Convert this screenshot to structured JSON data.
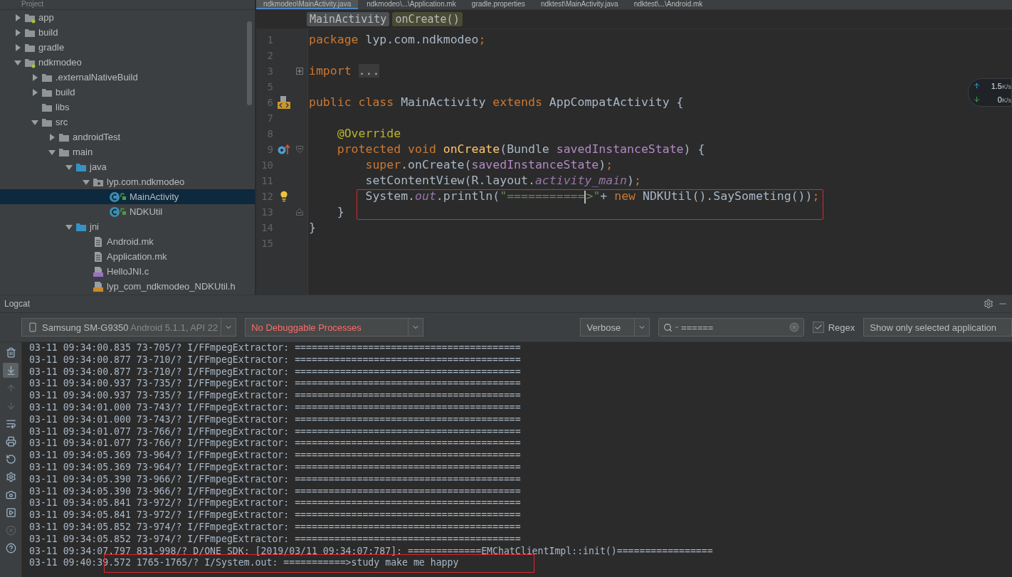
{
  "project_panel": {
    "title": "Project",
    "tree": [
      {
        "label": "app",
        "kind": "module",
        "expanded": false,
        "selected": false
      },
      {
        "label": "build",
        "kind": "folder",
        "expanded": false,
        "selected": false
      },
      {
        "label": "gradle",
        "kind": "folder",
        "expanded": false,
        "selected": false
      },
      {
        "label": "ndkmodeo",
        "kind": "module",
        "expanded": true,
        "selected": false,
        "children": [
          {
            "label": ".externalNativeBuild",
            "kind": "folder",
            "expanded": false,
            "selected": false
          },
          {
            "label": "build",
            "kind": "folder",
            "expanded": false,
            "selected": false
          },
          {
            "label": "libs",
            "kind": "folder",
            "selected": false
          },
          {
            "label": "src",
            "kind": "folder",
            "expanded": true,
            "selected": false,
            "children": [
              {
                "label": "androidTest",
                "kind": "folder",
                "expanded": false,
                "selected": false
              },
              {
                "label": "main",
                "kind": "folder",
                "expanded": true,
                "selected": false,
                "children": [
                  {
                    "label": "java",
                    "kind": "source",
                    "expanded": true,
                    "selected": false,
                    "children": [
                      {
                        "label": "lyp.com.ndkmodeo",
                        "kind": "package",
                        "expanded": true,
                        "selected": false,
                        "children": [
                          {
                            "label": "MainActivity",
                            "kind": "class",
                            "selected": true
                          },
                          {
                            "label": "NDKUtil",
                            "kind": "class",
                            "selected": false
                          }
                        ]
                      }
                    ]
                  },
                  {
                    "label": "jni",
                    "kind": "source",
                    "expanded": true,
                    "selected": false,
                    "children": [
                      {
                        "label": "Android.mk",
                        "kind": "text",
                        "selected": false
                      },
                      {
                        "label": "Application.mk",
                        "kind": "text",
                        "selected": false
                      },
                      {
                        "label": "HelloJNI.c",
                        "kind": "c",
                        "selected": false
                      },
                      {
                        "label": "lyp_com_ndkmodeo_NDKUtil.h",
                        "kind": "h",
                        "selected": false
                      }
                    ]
                  }
                ]
              }
            ]
          }
        ]
      }
    ]
  },
  "editor_tabs": [
    {
      "label": "ndkmodeo\\MainActivity.java",
      "selected": true
    },
    {
      "label": "ndkmodeo\\...\\Application.mk",
      "selected": false
    },
    {
      "label": "gradle.properties",
      "selected": false
    },
    {
      "label": "ndktest\\MainActivity.java",
      "selected": false
    },
    {
      "label": "ndktest\\...\\Android.mk",
      "selected": false
    }
  ],
  "breadcrumbs": [
    {
      "label": "MainActivity",
      "selected": false
    },
    {
      "label": "onCreate()",
      "selected": true
    }
  ],
  "code_lines": [
    {
      "number": "1",
      "tokens": [
        {
          "kind": "kw",
          "text": "package"
        },
        {
          "kind": "plain",
          "text": " lyp.com.ndkmodeo"
        },
        {
          "kind": "kw",
          "text": ";"
        }
      ]
    },
    {
      "number": "2"
    },
    {
      "number": "3",
      "gutter": [
        {
          "kind": "fold-plus"
        }
      ],
      "tokens": [
        {
          "kind": "kw",
          "text": "import"
        },
        {
          "kind": "folded",
          "text": "..."
        }
      ]
    },
    {
      "number": "5"
    },
    {
      "number": "6",
      "gutter": [
        {
          "kind": "layout"
        }
      ],
      "tokens": [
        {
          "kind": "kw",
          "text": "public class "
        },
        {
          "kind": "plain",
          "text": "MainActivity "
        },
        {
          "kind": "kw",
          "text": "extends "
        },
        {
          "kind": "plain",
          "text": "AppCompatActivity {"
        }
      ]
    },
    {
      "number": "7"
    },
    {
      "number": "8",
      "tokens": [
        {
          "kind": "annot",
          "text": "    @Override"
        }
      ]
    },
    {
      "number": "9",
      "gutter": [
        {
          "kind": "override"
        },
        {
          "kind": "fold-open"
        }
      ],
      "tokens": [
        {
          "kind": "kw",
          "text": "    protected void "
        },
        {
          "kind": "decl",
          "text": "onCreate"
        },
        {
          "kind": "plain",
          "text": "(Bundle "
        },
        {
          "kind": "param",
          "text": "savedInstanceState"
        },
        {
          "kind": "plain",
          "text": ") {"
        }
      ]
    },
    {
      "number": "10",
      "tokens": [
        {
          "kind": "kw",
          "text": "        super"
        },
        {
          "kind": "plain",
          "text": ".onCreate("
        },
        {
          "kind": "param",
          "text": "savedInstanceState"
        },
        {
          "kind": "plain",
          "text": ")"
        },
        {
          "kind": "kw",
          "text": ";"
        }
      ]
    },
    {
      "number": "11",
      "tokens": [
        {
          "kind": "plain",
          "text": "        setContentView(R.layout."
        },
        {
          "kind": "field",
          "text": "activity_main"
        },
        {
          "kind": "plain",
          "text": ")"
        },
        {
          "kind": "kw",
          "text": ";"
        }
      ]
    },
    {
      "number": "12",
      "gutter": [
        {
          "kind": "bulb"
        }
      ],
      "boxed": true,
      "tokens": [
        {
          "kind": "plain",
          "text": "        System."
        },
        {
          "kind": "field",
          "text": "out"
        },
        {
          "kind": "plain",
          "text": ".println("
        },
        {
          "kind": "str",
          "text": "\"==========="
        },
        {
          "kind": "caret"
        },
        {
          "kind": "str",
          "text": ">\""
        },
        {
          "kind": "plain",
          "text": "+ "
        },
        {
          "kind": "kw",
          "text": "new "
        },
        {
          "kind": "plain",
          "text": "NDKUtil().SaySometing())"
        },
        {
          "kind": "kw",
          "text": ";"
        }
      ]
    },
    {
      "number": "13",
      "gutter": [
        {
          "kind": "fold-close"
        }
      ],
      "boxed": true,
      "tokens": [
        {
          "kind": "plain",
          "text": "    }"
        }
      ]
    },
    {
      "number": "14",
      "tokens": [
        {
          "kind": "plain",
          "text": "}"
        }
      ]
    },
    {
      "number": "15"
    }
  ],
  "network_meter": {
    "up": "1.5",
    "up_unit": "K/s",
    "down": "0",
    "down_unit": "K/s"
  },
  "logcat": {
    "title": "Logcat",
    "device": {
      "name": "Samsung SM-G9350",
      "detail": "Android 5.1.1, API 22"
    },
    "process": "No Debuggable Processes",
    "level": "Verbose",
    "search": {
      "value": "======"
    },
    "regex": {
      "label": "Regex",
      "checked": true
    },
    "filter": "Show only selected application",
    "tools": [
      {
        "kind": "trash",
        "selected": false,
        "disabled": false
      },
      {
        "kind": "scroll-end",
        "selected": true,
        "disabled": false
      },
      {
        "kind": "up",
        "selected": false,
        "disabled": true
      },
      {
        "kind": "down",
        "selected": false,
        "disabled": true
      },
      {
        "kind": "wrap",
        "selected": false,
        "disabled": false
      },
      {
        "kind": "print",
        "selected": false,
        "disabled": false
      },
      {
        "kind": "restart",
        "selected": false,
        "disabled": false
      },
      {
        "kind": "settings",
        "selected": false,
        "disabled": false
      },
      {
        "kind": "camera",
        "selected": false,
        "disabled": false
      },
      {
        "kind": "record",
        "selected": false,
        "disabled": false
      },
      {
        "kind": "stop",
        "selected": false,
        "disabled": true
      },
      {
        "kind": "help",
        "selected": false,
        "disabled": false
      }
    ],
    "lines": [
      {
        "text": "03-11 09:34:00.835 73-705/? I/FFmpegExtractor: ========================================",
        "boxed": false
      },
      {
        "text": "03-11 09:34:00.877 73-710/? I/FFmpegExtractor: ========================================",
        "boxed": false
      },
      {
        "text": "03-11 09:34:00.877 73-710/? I/FFmpegExtractor: ========================================",
        "boxed": false
      },
      {
        "text": "03-11 09:34:00.937 73-735/? I/FFmpegExtractor: ========================================",
        "boxed": false
      },
      {
        "text": "03-11 09:34:00.937 73-735/? I/FFmpegExtractor: ========================================",
        "boxed": false
      },
      {
        "text": "03-11 09:34:01.000 73-743/? I/FFmpegExtractor: ========================================",
        "boxed": false
      },
      {
        "text": "03-11 09:34:01.000 73-743/? I/FFmpegExtractor: ========================================",
        "boxed": false
      },
      {
        "text": "03-11 09:34:01.077 73-766/? I/FFmpegExtractor: ========================================",
        "boxed": false
      },
      {
        "text": "03-11 09:34:01.077 73-766/? I/FFmpegExtractor: ========================================",
        "boxed": false
      },
      {
        "text": "03-11 09:34:05.369 73-964/? I/FFmpegExtractor: ========================================",
        "boxed": false
      },
      {
        "text": "03-11 09:34:05.369 73-964/? I/FFmpegExtractor: ========================================",
        "boxed": false
      },
      {
        "text": "03-11 09:34:05.390 73-966/? I/FFmpegExtractor: ========================================",
        "boxed": false
      },
      {
        "text": "03-11 09:34:05.390 73-966/? I/FFmpegExtractor: ========================================",
        "boxed": false
      },
      {
        "text": "03-11 09:34:05.841 73-972/? I/FFmpegExtractor: ========================================",
        "boxed": false
      },
      {
        "text": "03-11 09:34:05.841 73-972/? I/FFmpegExtractor: ========================================",
        "boxed": false
      },
      {
        "text": "03-11 09:34:05.852 73-974/? I/FFmpegExtractor: ========================================",
        "boxed": false
      },
      {
        "text": "03-11 09:34:05.852 73-974/? I/FFmpegExtractor: ========================================",
        "boxed": false
      },
      {
        "text": "03-11 09:34:07.797 831-998/? D/ONE SDK: [2019/03/11 09:34:07:787]: =============EMChatClientImpl::init()=================",
        "boxed": false
      },
      {
        "text": "03-11 09:40:39.572 1765-1765/? I/System.out: ===========>study make me happy",
        "boxed": true
      }
    ]
  }
}
